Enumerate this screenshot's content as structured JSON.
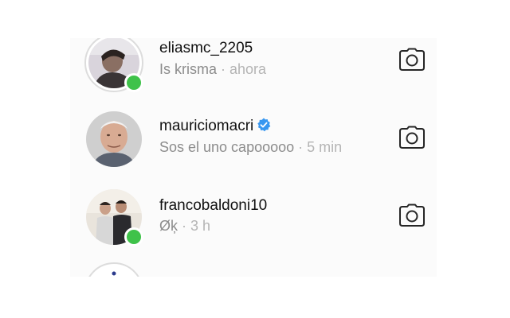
{
  "conversations": [
    {
      "username": "eliasmc_2205",
      "message": "Is krisma",
      "time": "ahora",
      "separator": "·",
      "online": true,
      "verified": false
    },
    {
      "username": "mauriciomacri",
      "message": "Sos el uno capooooo",
      "time": "5 min",
      "separator": "·",
      "online": false,
      "verified": true
    },
    {
      "username": "francobaldoni10",
      "message": "Øķ",
      "time": "3 h",
      "separator": "·",
      "online": true,
      "verified": false
    }
  ],
  "colors": {
    "online": "#3fc24a",
    "verified": "#3897f0",
    "secondary_text": "#9a9a9a"
  },
  "icons": {
    "row_action": "camera-icon",
    "verified": "verified-badge-icon",
    "presence": "online-status-dot"
  }
}
